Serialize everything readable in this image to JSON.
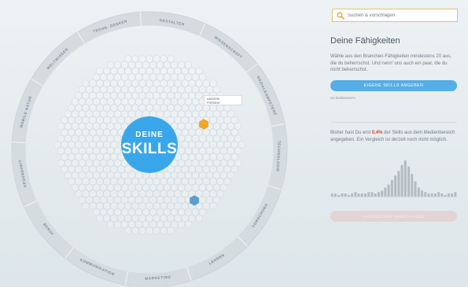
{
  "wheel": {
    "center_line1": "DEINE",
    "center_line2": "SKILLS",
    "ring_labels": [
      "TECHN. DENKEN",
      "GESTALTEN",
      "WISSENSCHAFT",
      "SOZIALKOMPETENZ",
      "TECHNOLOGIE",
      "FORSCHUNG",
      "LEHREN",
      "MARKETING",
      "KOMMUNIKATION",
      "BERUF",
      "GESUNDHEIT",
      "MOBILE NATUR",
      "WELTWISSEN"
    ],
    "popup_lines": [
      "ANDERE",
      "FREMDE"
    ],
    "colors": {
      "center": "#3aa6ea",
      "selected_orange": "#f5a623",
      "selected_blue": "#5d9ed0",
      "hex_outline": "#cfd8dc",
      "ring": "#d5dcdf"
    }
  },
  "search": {
    "placeholder": "Suchen & vorschlagen",
    "icon": "search-icon"
  },
  "panel": {
    "title": "Deine Fähigkeiten",
    "description": "Wähle aus den Branchen-Fähigkeiten mindestens 20 aus, die du beherrschst. Und nenn' uns auch ein paar, die du nicht beherrschst.",
    "button_label": "EIGENE SKILLS ANGEBEN",
    "link_label": "Zu-funktioniert's",
    "stats_before": "Bisher hast Du erst ",
    "stats_pct": "0,4%",
    "stats_after": " der Skills aus dem Medienbereich angegeben. Ein Vergleich ist derzeit noch nicht möglich.",
    "histogram": [
      2,
      2,
      1,
      2,
      2,
      1,
      2,
      3,
      2,
      2,
      2,
      3,
      3,
      2,
      3,
      4,
      6,
      8,
      11,
      14,
      17,
      21,
      24,
      20,
      15,
      10,
      6,
      4,
      3,
      2,
      2,
      2,
      3,
      2,
      1,
      2,
      2,
      3
    ],
    "compare_label": "VERGLEICHEN VORSCHLAGEN"
  }
}
